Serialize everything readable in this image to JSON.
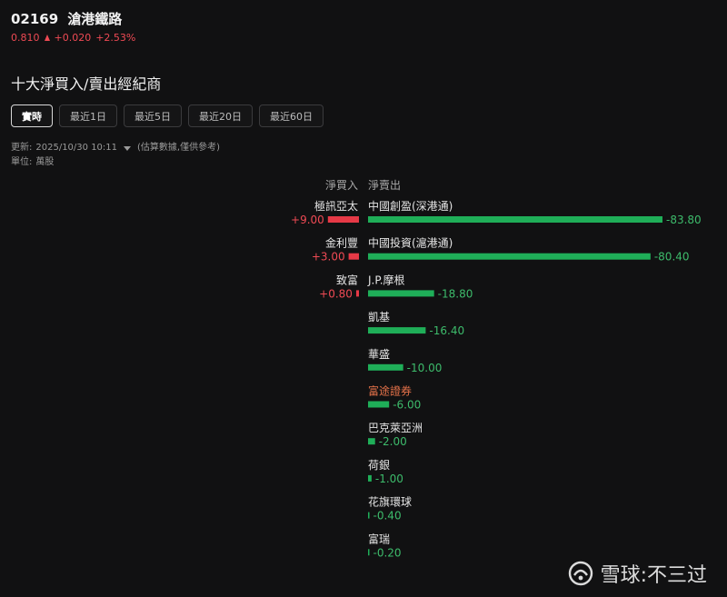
{
  "stock": {
    "code": "02169",
    "name": "滄港鐵路",
    "price": "0.810",
    "change": "+0.020",
    "change_pct": "+2.53%"
  },
  "section": {
    "title": "十大淨買入/賣出經紀商"
  },
  "tabs": [
    {
      "label": "實時",
      "active": true
    },
    {
      "label": "最近1日",
      "active": false
    },
    {
      "label": "最近5日",
      "active": false
    },
    {
      "label": "最近20日",
      "active": false
    },
    {
      "label": "最近60日",
      "active": false
    }
  ],
  "meta": {
    "update_label": "更新:",
    "update_time": "2025/10/30 10:11",
    "update_note": "(估算數據,僅供參考)",
    "unit_label": "單位:",
    "unit_value": "萬股"
  },
  "columns": {
    "buy": "淨買入",
    "sell": "淨賣出"
  },
  "colors": {
    "buy": "#e63946",
    "sell": "#1fae58",
    "buy_text": "#ef4a54",
    "sell_text": "#3dbb6b",
    "highlight": "#e8734a"
  },
  "chart_data": {
    "type": "bar",
    "buy": [
      {
        "name": "極訊亞太",
        "value": 9.0,
        "label": "+9.00"
      },
      {
        "name": "金利豐",
        "value": 3.0,
        "label": "+3.00"
      },
      {
        "name": "致富",
        "value": 0.8,
        "label": "+0.80"
      }
    ],
    "sell": [
      {
        "name": "中國創盈(深港通)",
        "value": -83.8,
        "label": "-83.80",
        "highlight": false
      },
      {
        "name": "中國投資(滬港通)",
        "value": -80.4,
        "label": "-80.40",
        "highlight": false
      },
      {
        "name": "J.P.摩根",
        "value": -18.8,
        "label": "-18.80",
        "highlight": false
      },
      {
        "name": "凱基",
        "value": -16.4,
        "label": "-16.40",
        "highlight": false
      },
      {
        "name": "華盛",
        "value": -10.0,
        "label": "-10.00",
        "highlight": false
      },
      {
        "name": "富途證券",
        "value": -6.0,
        "label": "-6.00",
        "highlight": true
      },
      {
        "name": "巴克萊亞洲",
        "value": -2.0,
        "label": "-2.00",
        "highlight": false
      },
      {
        "name": "荷銀",
        "value": -1.0,
        "label": "-1.00",
        "highlight": false
      },
      {
        "name": "花旗環球",
        "value": -0.4,
        "label": "-0.40",
        "highlight": false
      },
      {
        "name": "富瑞",
        "value": -0.2,
        "label": "-0.20",
        "highlight": false
      }
    ]
  },
  "watermark": {
    "text": "雪球:不三过"
  }
}
